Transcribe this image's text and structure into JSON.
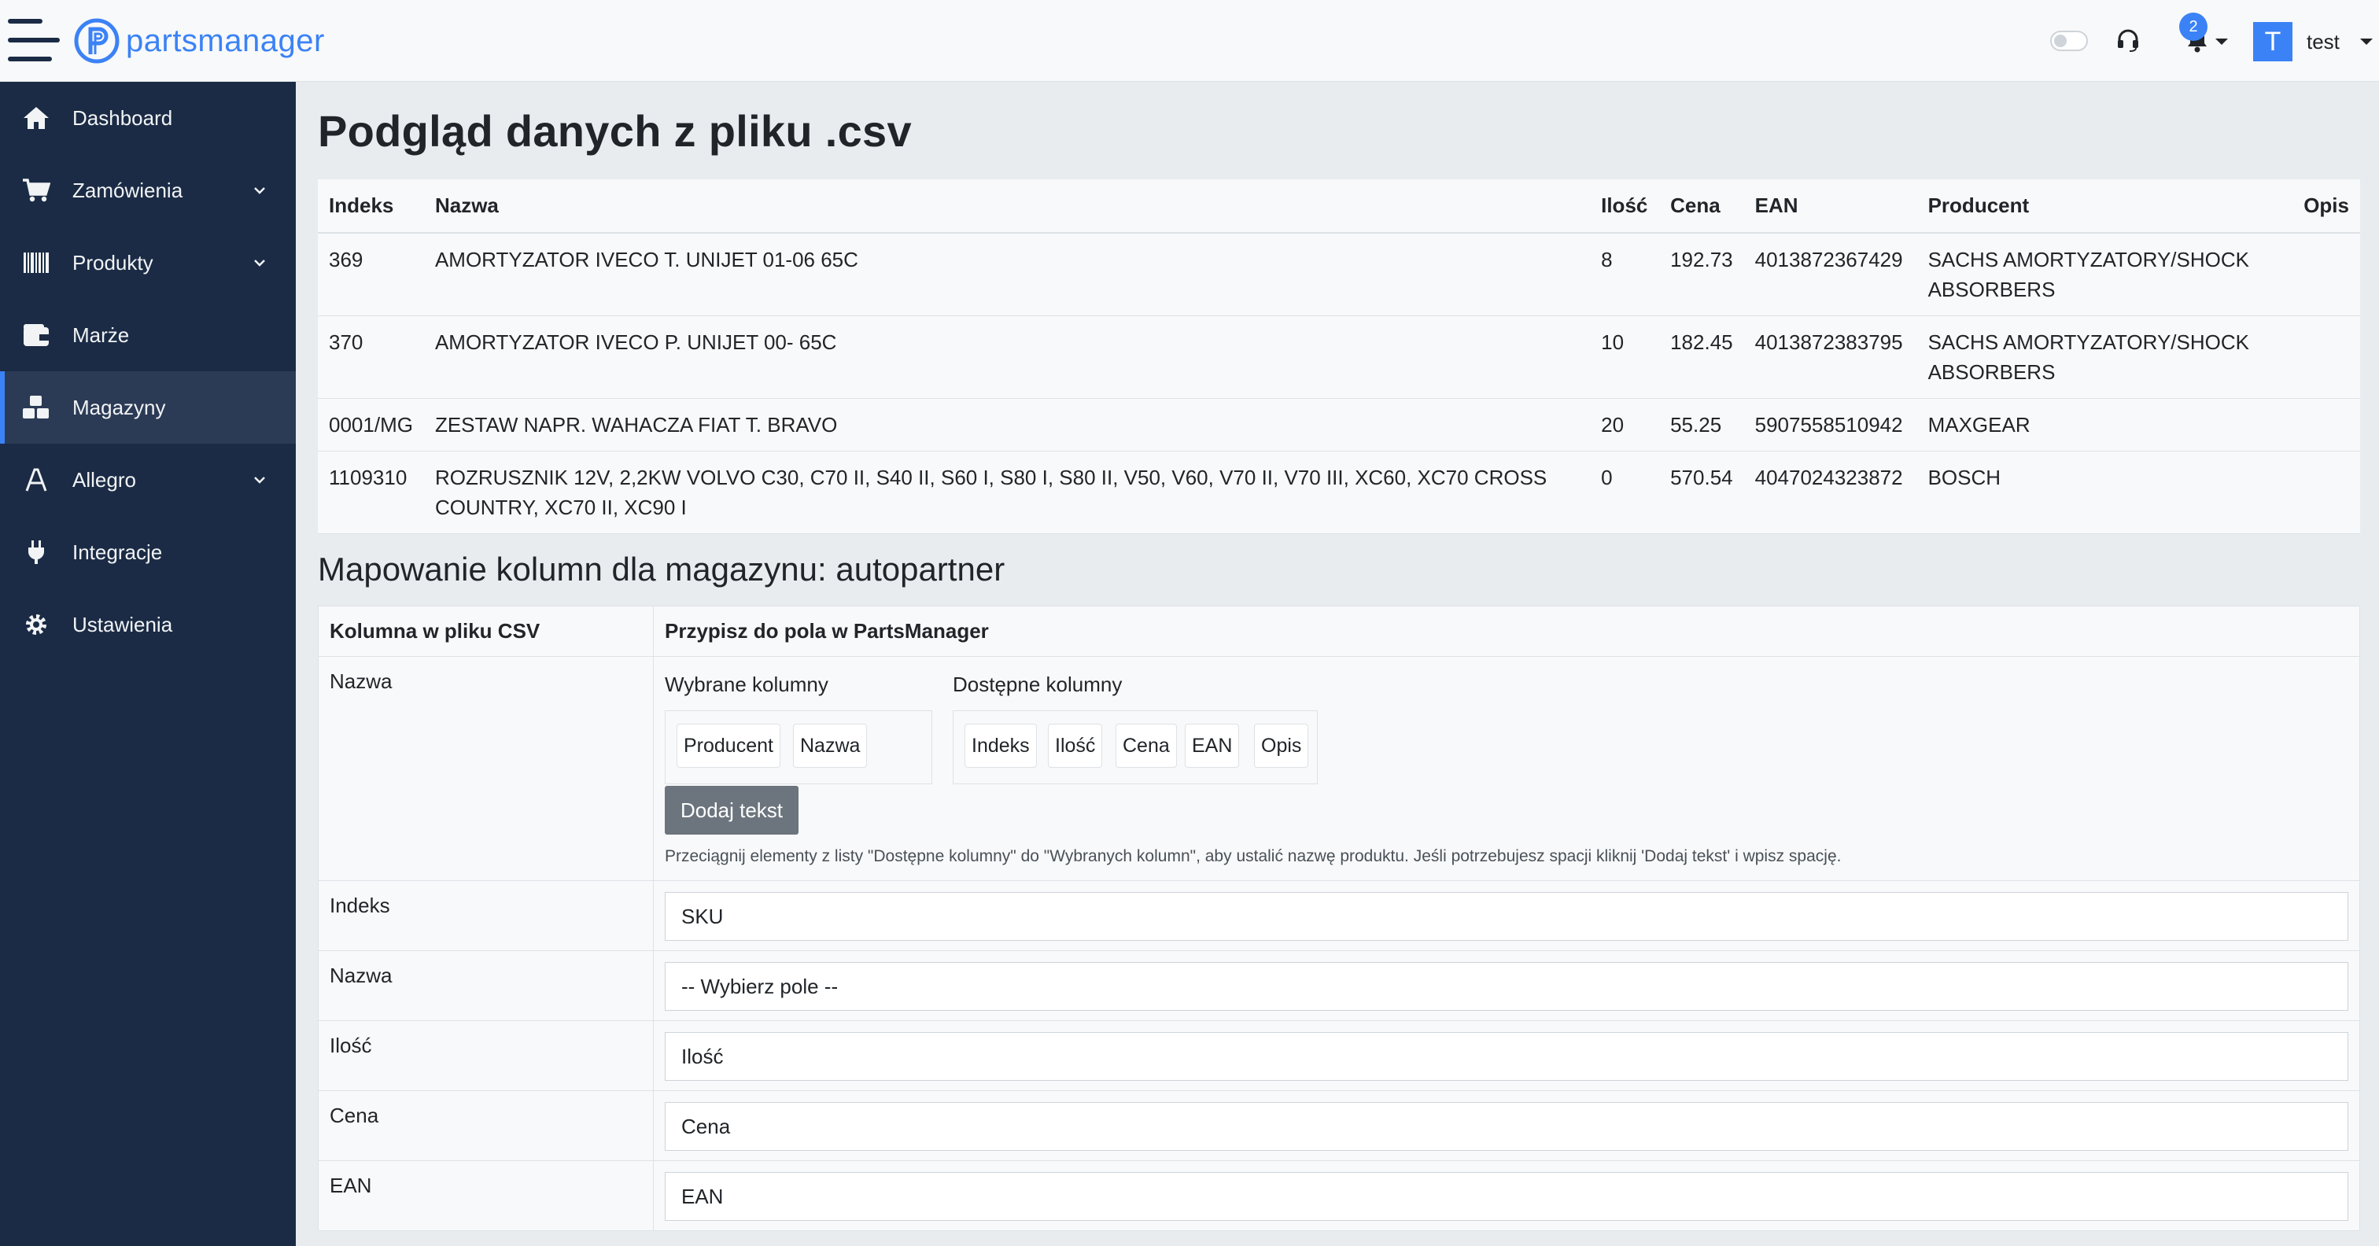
{
  "app": {
    "brand": "partsmanager"
  },
  "header": {
    "notifications_count": "2",
    "user_initial": "T",
    "username": "test"
  },
  "sidebar": {
    "items": [
      {
        "label": "Dashboard",
        "icon": "home-icon"
      },
      {
        "label": "Zamówienia",
        "icon": "cart-icon",
        "expandable": true
      },
      {
        "label": "Produkty",
        "icon": "barcode-icon",
        "expandable": true
      },
      {
        "label": "Marże",
        "icon": "wallet-icon"
      },
      {
        "label": "Magazyny",
        "icon": "boxes-icon",
        "active": true
      },
      {
        "label": "Allegro",
        "icon": "allegro-icon",
        "expandable": true
      },
      {
        "label": "Integracje",
        "icon": "plug-icon"
      },
      {
        "label": "Ustawienia",
        "icon": "gear-icon"
      }
    ]
  },
  "page": {
    "title": "Podgląd danych z pliku .csv"
  },
  "preview": {
    "headers": [
      "Indeks",
      "Nazwa",
      "Ilość",
      "Cena",
      "EAN",
      "Producent",
      "Opis"
    ],
    "rows": [
      [
        "369",
        "AMORTYZATOR IVECO T. UNIJET 01-06 65C",
        "8",
        "192.73",
        "4013872367429",
        "SACHS AMORTYZATORY/SHOCK ABSORBERS",
        ""
      ],
      [
        "370",
        "AMORTYZATOR IVECO P. UNIJET 00- 65C",
        "10",
        "182.45",
        "4013872383795",
        "SACHS AMORTYZATORY/SHOCK ABSORBERS",
        ""
      ],
      [
        "0001/MG",
        "ZESTAW NAPR. WAHACZA FIAT T. BRAVO",
        "20",
        "55.25",
        "5907558510942",
        "MAXGEAR",
        ""
      ],
      [
        "1109310",
        "ROZRUSZNIK 12V, 2,2KW VOLVO C30, C70 II, S40 II, S60 I, S80 I, S80 II, V50, V60, V70 II, V70 III, XC60, XC70 CROSS COUNTRY, XC70 II, XC90 I",
        "0",
        "570.54",
        "4047024323872",
        "BOSCH",
        ""
      ]
    ]
  },
  "mapping": {
    "title": "Mapowanie kolumn dla magazynu: autopartner",
    "headers": [
      "Kolumna w pliku CSV",
      "Przypisz do pola w PartsManager"
    ],
    "name_builder": {
      "csv_column": "Nazwa",
      "selected_label": "Wybrane kolumny",
      "selected": [
        "Producent",
        "Nazwa"
      ],
      "available_label": "Dostępne kolumny",
      "available": [
        "Indeks",
        "Ilość",
        "Cena",
        "EAN",
        "Opis"
      ],
      "add_text_label": "Dodaj tekst",
      "hint": "Przeciągnij elementy z listy \"Dostępne kolumny\" do \"Wybranych kolumn\", aby ustalić nazwę produktu. Jeśli potrzebujesz spacji kliknij 'Dodaj tekst' i wpisz spację."
    },
    "rows": [
      {
        "csv_column": "Indeks",
        "selected": "SKU"
      },
      {
        "csv_column": "Nazwa",
        "selected": "-- Wybierz pole --"
      },
      {
        "csv_column": "Ilość",
        "selected": "Ilość"
      },
      {
        "csv_column": "Cena",
        "selected": "Cena"
      },
      {
        "csv_column": "EAN",
        "selected": "EAN"
      }
    ]
  }
}
